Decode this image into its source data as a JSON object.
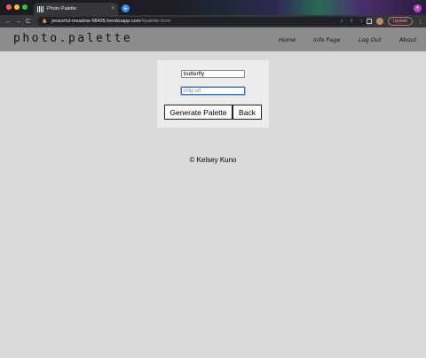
{
  "browser": {
    "tab_title": "Photo Palette",
    "tab_close": "×",
    "new_tab": "+",
    "url_host": "peaceful-meadow-98495.herokuapp.com",
    "url_path": "/#palette-form",
    "nav_back": "←",
    "nav_forward": "→",
    "nav_reload": "C",
    "update_label": "Update",
    "menu": "⋮"
  },
  "site": {
    "brand": "photo.palette",
    "nav": {
      "home": "Home",
      "info": "Info Page",
      "logout": "Log Out",
      "about": "About"
    }
  },
  "form": {
    "name_value": "butterfly",
    "url_placeholder": "img url",
    "generate_label": "Generate Palette",
    "back_label": "Back"
  },
  "footer": {
    "copyright": "© Kelsey Kuno"
  }
}
